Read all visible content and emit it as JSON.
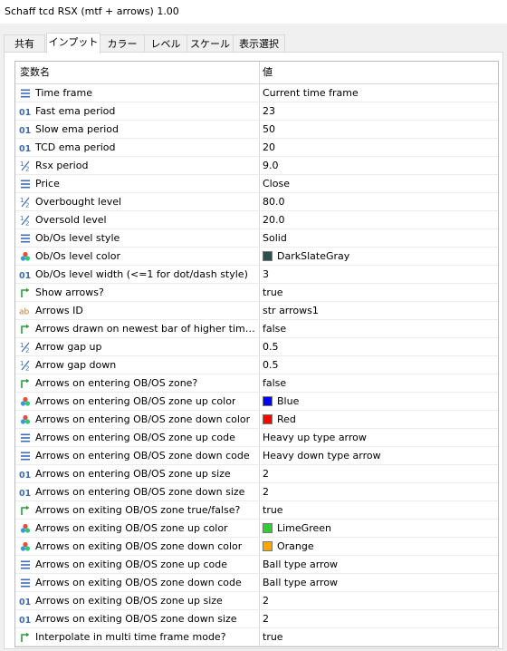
{
  "window": {
    "title": "Schaff tcd RSX (mtf + arrows) 1.00"
  },
  "tabs": [
    {
      "label": "共有"
    },
    {
      "label": "インプット"
    },
    {
      "label": "カラー"
    },
    {
      "label": "レベル"
    },
    {
      "label": "スケール"
    },
    {
      "label": "表示選択"
    }
  ],
  "grid": {
    "headers": {
      "name": "変数名",
      "value": "値"
    },
    "rows": [
      {
        "icon": "enum-icon",
        "name": "Time frame",
        "value": "Current time frame"
      },
      {
        "icon": "integer-icon",
        "name": "Fast ema period",
        "value": "23"
      },
      {
        "icon": "integer-icon",
        "name": "Slow ema period",
        "value": "50"
      },
      {
        "icon": "integer-icon",
        "name": "TCD ema period",
        "value": "20"
      },
      {
        "icon": "double-icon",
        "name": "Rsx period",
        "value": "9.0"
      },
      {
        "icon": "enum-icon",
        "name": "Price",
        "value": "Close"
      },
      {
        "icon": "double-icon",
        "name": "Overbought level",
        "value": "80.0"
      },
      {
        "icon": "double-icon",
        "name": "Oversold level",
        "value": "20.0"
      },
      {
        "icon": "enum-icon",
        "name": "Ob/Os level style",
        "value": "Solid"
      },
      {
        "icon": "color-icon",
        "name": "Ob/Os level color",
        "value": "DarkSlateGray",
        "swatch": "#2f4f4f"
      },
      {
        "icon": "integer-icon",
        "name": "Ob/Os level width (<=1 for dot/dash style)",
        "value": "3"
      },
      {
        "icon": "bool-icon",
        "name": "Show arrows?",
        "value": "true"
      },
      {
        "icon": "string-icon",
        "name": "Arrows ID",
        "value": "str arrows1"
      },
      {
        "icon": "bool-icon",
        "name": "Arrows drawn on newest bar of higher time f...",
        "value": "false"
      },
      {
        "icon": "double-icon",
        "name": "Arrow gap up",
        "value": "0.5"
      },
      {
        "icon": "double-icon",
        "name": "Arrow gap down",
        "value": "0.5"
      },
      {
        "icon": "bool-icon",
        "name": "Arrows on entering OB/OS zone?",
        "value": "false"
      },
      {
        "icon": "color-icon",
        "name": "Arrows on entering OB/OS zone up color",
        "value": "Blue",
        "swatch": "#0000ff"
      },
      {
        "icon": "color-icon",
        "name": "Arrows on entering OB/OS zone down color",
        "value": "Red",
        "swatch": "#ff0000"
      },
      {
        "icon": "enum-icon",
        "name": "Arrows on entering OB/OS zone up code",
        "value": "Heavy up type arrow"
      },
      {
        "icon": "enum-icon",
        "name": "Arrows on entering OB/OS zone down code",
        "value": "Heavy down type arrow"
      },
      {
        "icon": "integer-icon",
        "name": "Arrows on entering OB/OS zone up size",
        "value": "2"
      },
      {
        "icon": "integer-icon",
        "name": "Arrows on entering OB/OS zone down size",
        "value": "2"
      },
      {
        "icon": "bool-icon",
        "name": "Arrows on exiting OB/OS zone true/false?",
        "value": "true"
      },
      {
        "icon": "color-icon",
        "name": "Arrows on exiting OB/OS zone up color",
        "value": "LimeGreen",
        "swatch": "#32cd32"
      },
      {
        "icon": "color-icon",
        "name": "Arrows on exiting OB/OS zone down color",
        "value": "Orange",
        "swatch": "#ffa500"
      },
      {
        "icon": "enum-icon",
        "name": "Arrows on exiting OB/OS zone up code",
        "value": "Ball type arrow"
      },
      {
        "icon": "enum-icon",
        "name": "Arrows on exiting OB/OS zone down code",
        "value": "Ball type arrow"
      },
      {
        "icon": "integer-icon",
        "name": "Arrows on exiting OB/OS zone up size",
        "value": "2"
      },
      {
        "icon": "integer-icon",
        "name": "Arrows on exiting OB/OS zone down size",
        "value": "2"
      },
      {
        "icon": "bool-icon",
        "name": "Interpolate in multi time frame mode?",
        "value": "true"
      }
    ]
  }
}
